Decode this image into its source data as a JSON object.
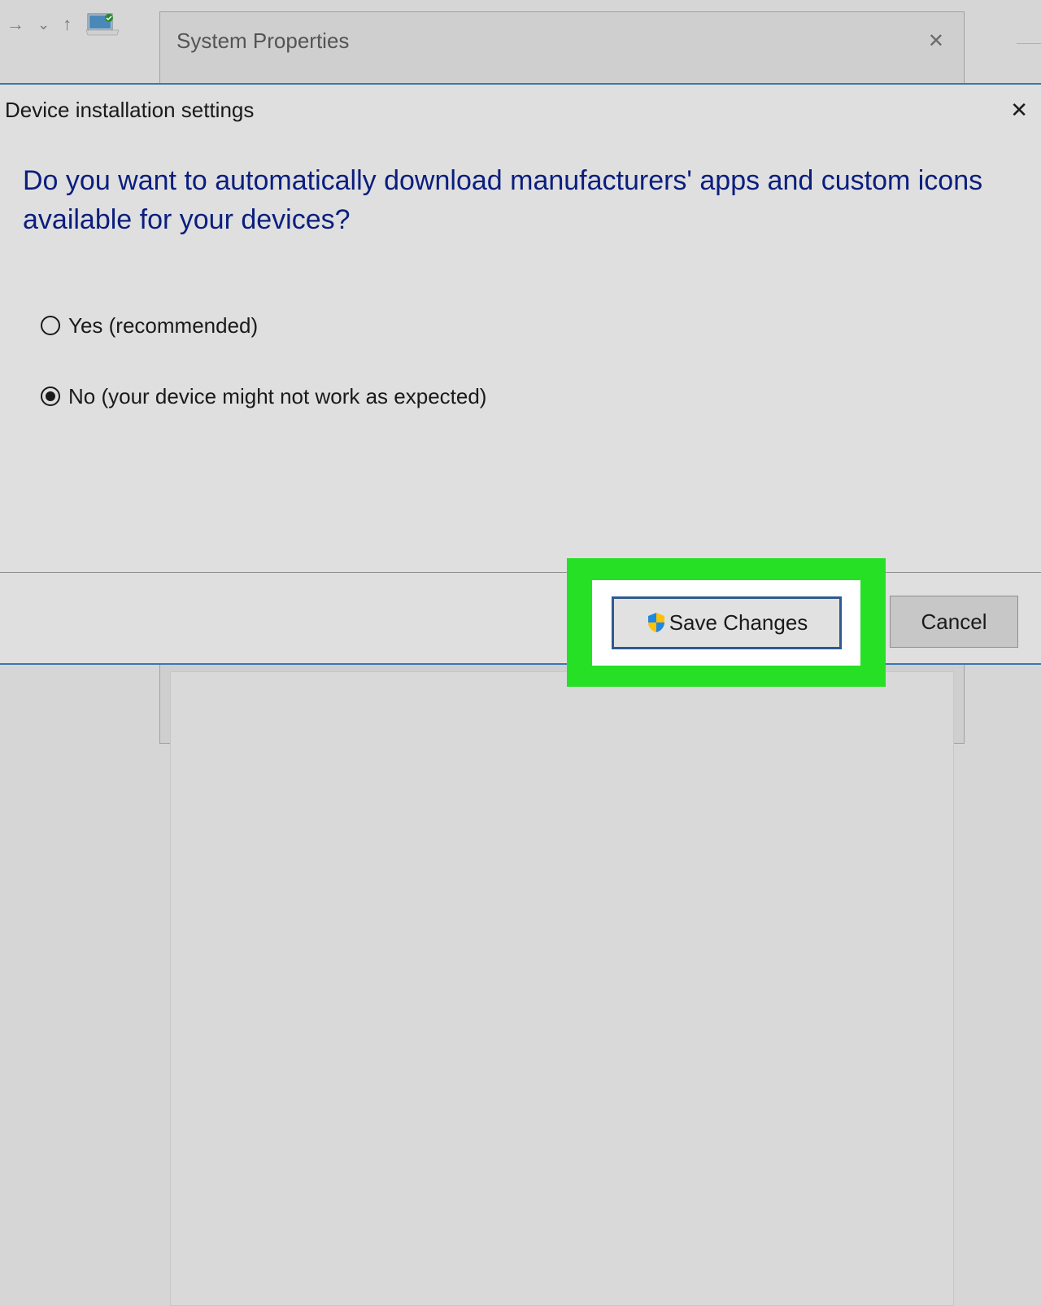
{
  "background_window": {
    "title": "System Properties"
  },
  "dialog": {
    "title": "Device installation settings",
    "question": "Do you want to automatically download manufacturers' apps and custom icons available for your devices?",
    "options": {
      "yes": {
        "label": "Yes (recommended)",
        "selected": false
      },
      "no": {
        "label": "No (your device might not work as expected)",
        "selected": true
      }
    },
    "buttons": {
      "save": "Save Changes",
      "cancel": "Cancel"
    }
  }
}
